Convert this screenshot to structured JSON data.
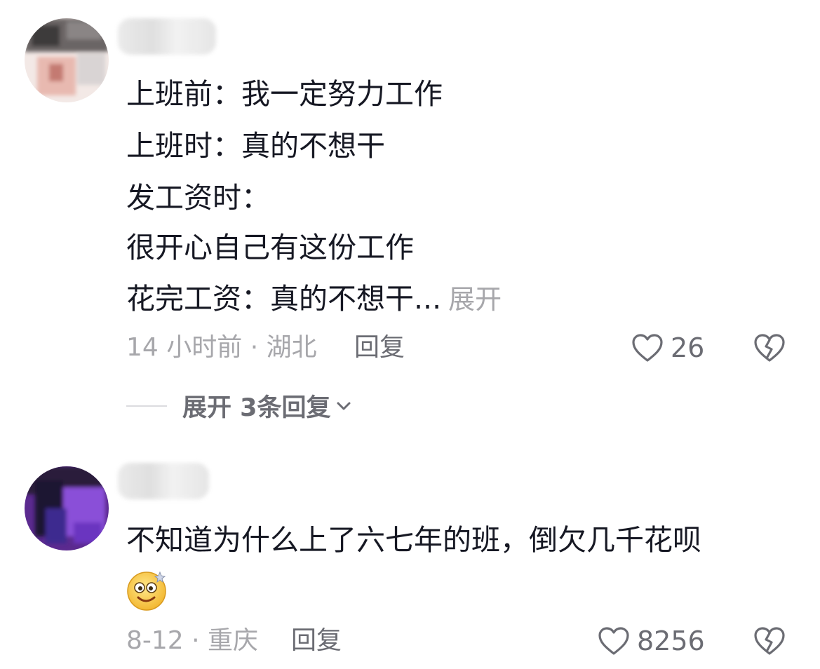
{
  "comments": [
    {
      "lines": [
        "上班前：我一定努力工作",
        "上班时：真的不想干",
        "发工资时：",
        "很开心自己有这份工作",
        "花完工资：真的不想干..."
      ],
      "expand_label": "展开",
      "meta": "14 小时前 · 湖北",
      "reply_label": "回复",
      "likes": "26",
      "expand_replies_label": "展开 3条回复"
    },
    {
      "lines": [
        "不知道为什么上了六七年的班，倒欠几千花呗"
      ],
      "emoji": "dizzy-smile-emoji",
      "meta": "8-12 · 重庆",
      "reply_label": "回复",
      "likes": "8256"
    }
  ],
  "icons": {
    "like": "heart-outline-icon",
    "dislike": "broken-heart-icon",
    "expand": "chevron-down-icon"
  },
  "colors": {
    "text": "#161823",
    "secondary": "#a7a7ab",
    "action": "#6b6c73"
  }
}
